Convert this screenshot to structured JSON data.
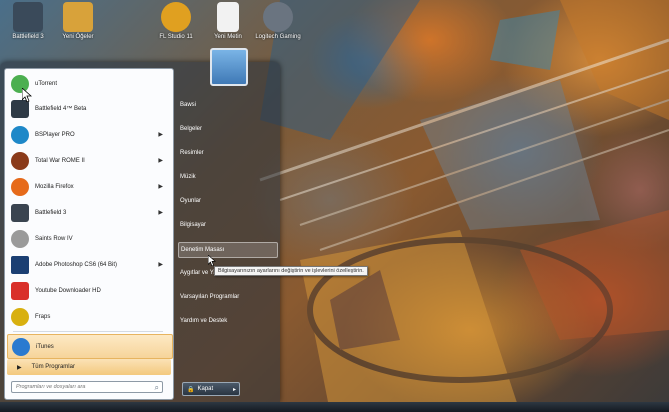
{
  "desktop_icons": [
    {
      "label": "Battlefield 3",
      "icon": "battlefield-icon",
      "color": "#3a4a5a"
    },
    {
      "label": "Yeni Öğeler",
      "icon": "folder-icon",
      "color": "#d8a23a"
    },
    {
      "label": "FL Studio 11",
      "icon": "fl-studio-icon",
      "color": "#e0a020"
    },
    {
      "label": "Yeni Metin",
      "icon": "document-icon",
      "color": "#f2f2f2"
    },
    {
      "label": "Logitech Gaming",
      "icon": "logitech-icon",
      "color": "#6a7480"
    }
  ],
  "start_menu": {
    "programs": [
      {
        "label": "uTorrent",
        "icon": "utorrent-icon",
        "color": "#4caf50",
        "arrow": ""
      },
      {
        "label": "Battlefield 4™ Beta",
        "icon": "battlefield-icon",
        "color": "#2e3a46",
        "arrow": ""
      },
      {
        "label": "BSPlayer PRO",
        "icon": "bsplayer-icon",
        "color": "#1e88c8",
        "arrow": "▶"
      },
      {
        "label": "Total War ROME II",
        "icon": "rome-icon",
        "color": "#8a3a1a",
        "arrow": "▶"
      },
      {
        "label": "Mozilla Firefox",
        "icon": "firefox-icon",
        "color": "#e66a1a",
        "arrow": "▶"
      },
      {
        "label": "Battlefield 3",
        "icon": "battlefield-icon",
        "color": "#3a4450",
        "arrow": "▶"
      },
      {
        "label": "Saints Row IV",
        "icon": "saints-row-icon",
        "color": "#9a9a9a",
        "arrow": ""
      },
      {
        "label": "Adobe Photoshop CS6 (64 Bit)",
        "icon": "photoshop-icon",
        "color": "#1b3f73",
        "arrow": "▶"
      },
      {
        "label": "Youtube Downloader HD",
        "icon": "youtube-icon",
        "color": "#d9302a",
        "arrow": ""
      },
      {
        "label": "Fraps",
        "icon": "fraps-icon",
        "color": "#d8b010",
        "arrow": ""
      },
      {
        "label": "iTunes",
        "icon": "itunes-icon",
        "color": "#2a7ad0",
        "arrow": ""
      }
    ],
    "all_programs_label": "Tüm Programlar",
    "search_placeholder": "Programları ve dosyaları ara",
    "right_items": [
      {
        "label": "Bawsi"
      },
      {
        "label": "Belgeler"
      },
      {
        "label": "Resimler"
      },
      {
        "label": "Müzik"
      },
      {
        "label": "Oyunlar"
      },
      {
        "label": "Bilgisayar"
      },
      {
        "label": "Denetim Masası"
      },
      {
        "label": "Aygıtlar ve Yazıcılar"
      },
      {
        "label": "Varsayılan Programlar"
      },
      {
        "label": "Yardım ve Destek"
      }
    ],
    "shutdown_label": "Kapat",
    "tooltip": "Bilgisayarınızın ayarlarını değiştirin ve işlevlerini özelleştirin."
  },
  "colors": {
    "highlight": "#f6d49a",
    "pane_bg": "#fbfcfe"
  }
}
